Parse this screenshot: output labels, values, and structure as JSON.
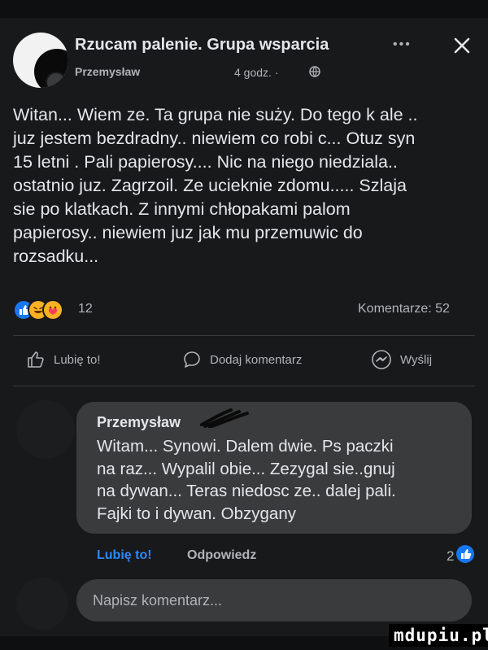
{
  "post": {
    "group_name": "Rzucam palenie. Grupa wsparcia",
    "author": "Przemysław",
    "time": "4 godz. ·",
    "more_icon": "more-horizontal-icon",
    "close_icon": "close-icon",
    "privacy_icon": "globe-icon",
    "text": "Witan... Wiem ze. Ta grupa nie suży. Do tego k ale ..\njuz jestem bezdradny.. niewiem co robi c... Otuz syn\n15 letni . Pali papierosy.... Nic na niego niedziala..\nostatnio juz. Zagrzoil. Ze ucieknie zdomu..... Szlaja\nsie po klatkach. Z innymi chłopakami palom\npapierosy.. niewiem juz jak mu przemuwic do\nrozsadku...",
    "reactions": {
      "icons": [
        "like-icon",
        "haha-icon",
        "care-icon"
      ],
      "count": "12"
    },
    "comments_count": "Komentarze: 52"
  },
  "actions": {
    "like": "Lubię to!",
    "comment": "Dodaj komentarz",
    "send": "Wyślij"
  },
  "comment": {
    "author": "Przemysław",
    "text": "Witam... Synowi. Dalem dwie. Ps paczki\nna raz... Wypalil obie... Zezygal sie..gnuj\nna dywan... Teras niedosc ze.. dalej pali.\nFajki to i dywan.  Obzygany",
    "like_label": "Lubię to!",
    "reply_label": "Odpowiedz",
    "reaction_count": "2",
    "reaction_icon": "like-icon"
  },
  "composer": {
    "placeholder": "Napisz komentarz..."
  },
  "watermark": "mdupiu.pl",
  "colors": {
    "background": "#18191a",
    "bubble": "#3a3b3c",
    "text": "#e4e6eb",
    "secondary": "#b0b3b8",
    "link_blue": "#2d88ff",
    "like_blue": "#1877f2"
  }
}
